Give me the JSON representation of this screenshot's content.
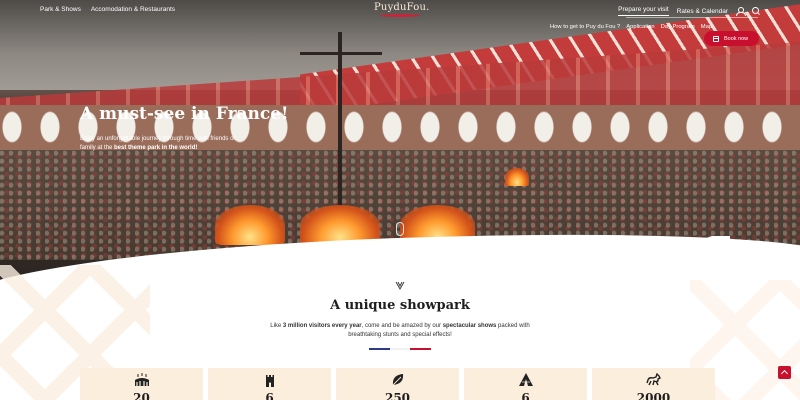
{
  "nav": {
    "left_links": [
      "Park & Shows",
      "Accomodation & Restaurants"
    ],
    "logo_text": "PuyduFou.",
    "right_links": [
      "Prepare your visit",
      "Rates & Calendar"
    ],
    "sub_links": [
      "How to get to Puy du Fou ?",
      "Application",
      "Day Program",
      "Map"
    ],
    "book_label": "Book now"
  },
  "hero": {
    "title": "A must-see in France!",
    "subtitle_plain": "Enjoy an unforgettable journey through time with friends or family at the ",
    "subtitle_bold": "best theme park in the world!"
  },
  "showpark": {
    "title": "A unique showpark",
    "text_1": "Like ",
    "text_bold_1": "3 million visitors every year",
    "text_2": ", come and be amazed by our ",
    "text_bold_2": "spectacular shows",
    "text_3": " packed with breathtaking stunts and special effects!"
  },
  "stats": [
    {
      "icon": "arena-icon",
      "value": "20"
    },
    {
      "icon": "castle-tower-icon",
      "value": "6"
    },
    {
      "icon": "leaf-icon",
      "value": "250"
    },
    {
      "icon": "tent-icon",
      "value": "6"
    },
    {
      "icon": "horse-icon",
      "value": "2000"
    }
  ],
  "colors": {
    "accent": "#c8102e",
    "stat_bg": "#fbeedd",
    "flag": [
      "#2b3a8c",
      "#ffffff",
      "#c8102e"
    ]
  }
}
